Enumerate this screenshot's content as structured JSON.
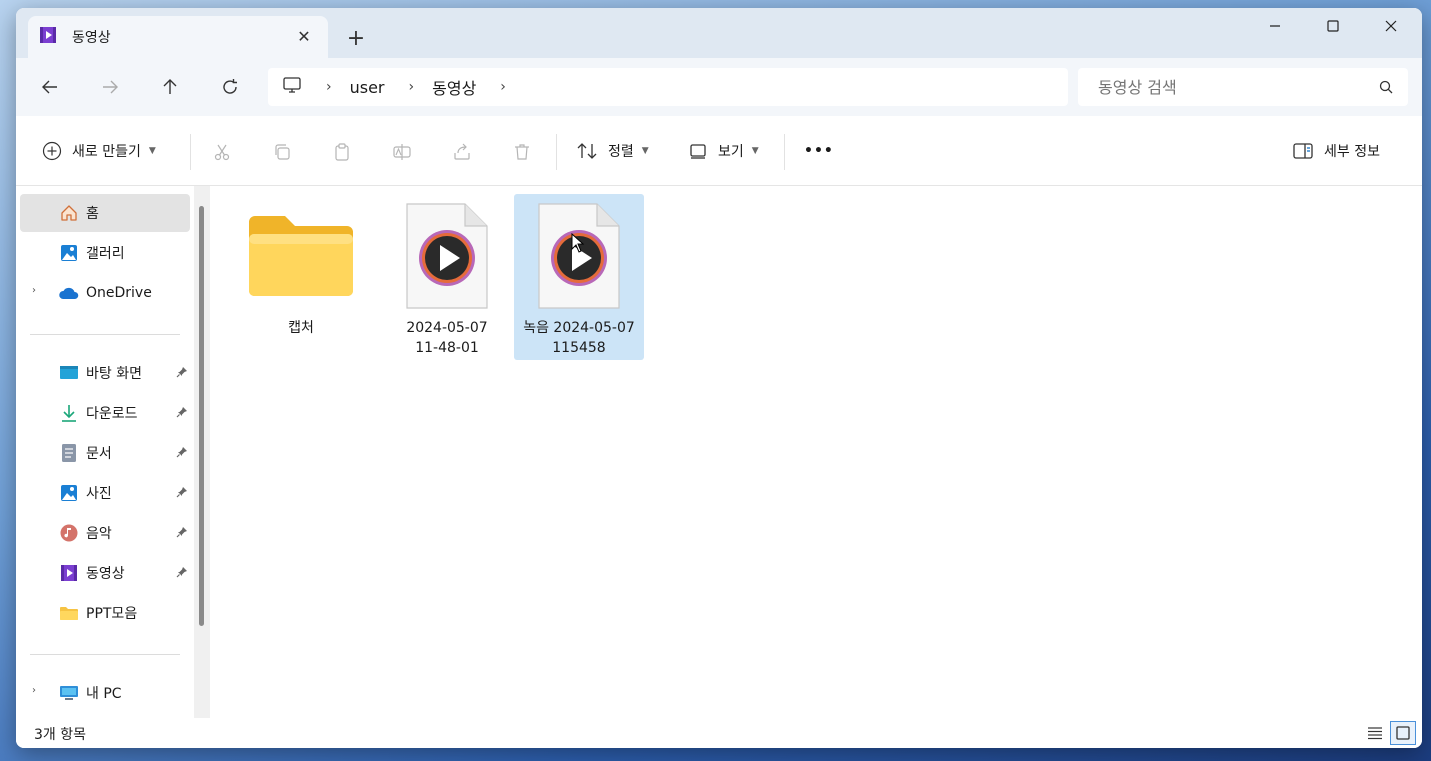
{
  "window": {
    "tab_title": "동영상",
    "tab_close": "✕",
    "new_tab": "+"
  },
  "breadcrumb": {
    "items": [
      "user",
      "동영상"
    ],
    "separator": "›"
  },
  "search": {
    "placeholder": "동영상 검색"
  },
  "toolbar": {
    "new_label": "새로 만들기",
    "sort_label": "정렬",
    "view_label": "보기",
    "more_label": "•••",
    "details_label": "세부 정보"
  },
  "sidebar": {
    "items": [
      {
        "label": "홈",
        "icon": "home-icon",
        "selected": true
      },
      {
        "label": "갤러리",
        "icon": "gallery-icon"
      },
      {
        "label": "OneDrive",
        "icon": "onedrive-icon",
        "expandable": true
      }
    ],
    "quick_access": [
      {
        "label": "바탕 화면",
        "icon": "desktop-icon",
        "pinned": true
      },
      {
        "label": "다운로드",
        "icon": "download-icon",
        "pinned": true
      },
      {
        "label": "문서",
        "icon": "documents-icon",
        "pinned": true
      },
      {
        "label": "사진",
        "icon": "pictures-icon",
        "pinned": true
      },
      {
        "label": "음악",
        "icon": "music-icon",
        "pinned": true
      },
      {
        "label": "동영상",
        "icon": "videos-icon",
        "pinned": true
      },
      {
        "label": "PPT모음",
        "icon": "folder-icon",
        "pinned": false
      }
    ],
    "this_pc": {
      "label": "내 PC",
      "icon": "pc-icon",
      "expandable": true
    },
    "expander_glyph": "›"
  },
  "files": [
    {
      "name": "캡처",
      "type": "folder",
      "selected": false
    },
    {
      "name": "2024-05-07\n11-48-01",
      "type": "video",
      "selected": false
    },
    {
      "name": "녹음 2024-05-07\n115458",
      "type": "video",
      "selected": true
    }
  ],
  "status": {
    "item_count": "3개 항목"
  },
  "colors": {
    "accent": "#0067c0",
    "selection": "#cce4f7",
    "folder": "#f6c343",
    "video_ring": "#c86a52"
  }
}
